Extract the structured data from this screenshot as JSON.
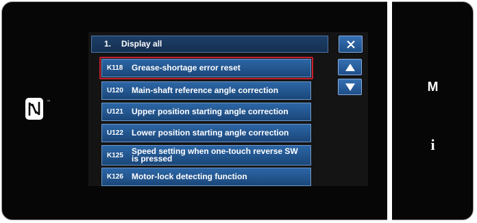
{
  "header": {
    "number": "1.",
    "title": "Display all"
  },
  "items": [
    {
      "code": "K118",
      "label": "Grease-shortage error reset"
    },
    {
      "code": "U120",
      "label": "Main-shaft reference angle correction"
    },
    {
      "code": "U121",
      "label": "Upper position starting angle correction"
    },
    {
      "code": "U122",
      "label": "Lower position starting angle correction"
    },
    {
      "code": "K125",
      "label": "Speed setting when one-touch reverse SW is pressed"
    },
    {
      "code": "K126",
      "label": "Motor-lock detecting function"
    }
  ],
  "side_keys": {
    "m": "M",
    "i": "i"
  },
  "trademark": "™",
  "colors": {
    "selection": "#c9202b",
    "button": "#2c66a6"
  }
}
